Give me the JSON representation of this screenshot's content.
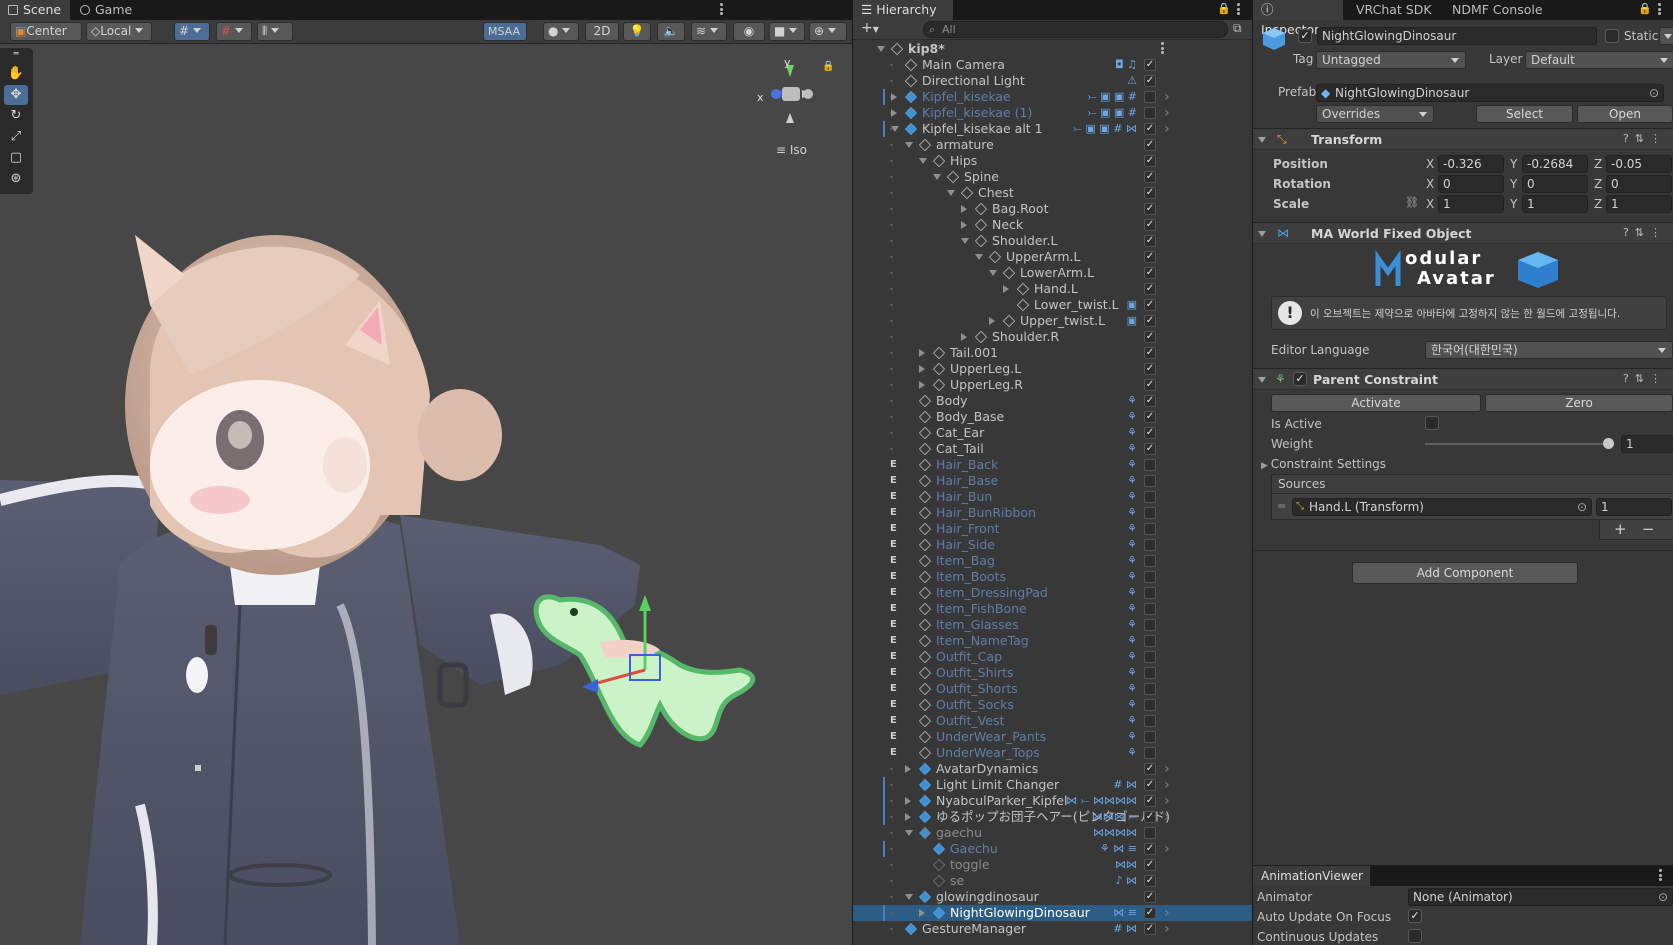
{
  "scene": {
    "tabs": [
      {
        "label": "Scene"
      },
      {
        "label": "Game"
      }
    ],
    "toolbar": {
      "pivot": "Center",
      "space": "Local",
      "msaa": "MSAA",
      "mode2d": "2D"
    },
    "iso_label": "Iso",
    "gizmo_axes": {
      "y": "y",
      "x": "x"
    }
  },
  "hierarchy": {
    "tab": "Hierarchy",
    "search_placeholder": "All",
    "rows": [
      {
        "label": "kip8*",
        "depth": 0,
        "fold": "down",
        "icon": "unity",
        "color": "white"
      },
      {
        "label": "Main Camera",
        "depth": 1,
        "fold": "none",
        "icon": "cube",
        "color": "white",
        "icons": "◘ ♫",
        "check": true
      },
      {
        "label": "Directional Light",
        "depth": 1,
        "fold": "none",
        "icon": "cube",
        "color": "white",
        "icons": "⚠",
        "check": true
      },
      {
        "label": "Kipfel_kisekae",
        "depth": 1,
        "fold": "right",
        "icon": "prefab",
        "color": "dblue",
        "icons": "⤚ ▣ ▣ #",
        "check": false,
        "bar": true,
        "arr": true
      },
      {
        "label": "Kipfel_kisekae (1)",
        "depth": 1,
        "fold": "right",
        "icon": "prefab",
        "color": "dblue",
        "icons": "⤚ ▣ ▣ #",
        "check": false,
        "arr": true
      },
      {
        "label": "Kipfel_kisekae alt 1",
        "depth": 1,
        "fold": "down",
        "icon": "prefab",
        "color": "blue",
        "icons": "⤚ ▣ ▣ # ⋈",
        "check": true,
        "bar": true,
        "arr": true
      },
      {
        "label": "armature",
        "depth": 2,
        "fold": "down",
        "icon": "cube",
        "color": "blue",
        "check": true
      },
      {
        "label": "Hips",
        "depth": 3,
        "fold": "down",
        "icon": "cube",
        "color": "blue",
        "check": true
      },
      {
        "label": "Spine",
        "depth": 4,
        "fold": "down",
        "icon": "cube",
        "color": "blue",
        "check": true
      },
      {
        "label": "Chest",
        "depth": 5,
        "fold": "down",
        "icon": "cube",
        "color": "blue",
        "check": true
      },
      {
        "label": "Bag.Root",
        "depth": 6,
        "fold": "right",
        "icon": "cube",
        "color": "blue",
        "check": true
      },
      {
        "label": "Neck",
        "depth": 6,
        "fold": "right",
        "icon": "cube",
        "color": "blue",
        "check": true
      },
      {
        "label": "Shoulder.L",
        "depth": 6,
        "fold": "down",
        "icon": "cube",
        "color": "blue",
        "check": true
      },
      {
        "label": "UpperArm.L",
        "depth": 7,
        "fold": "down",
        "icon": "cube",
        "color": "blue",
        "check": true
      },
      {
        "label": "LowerArm.L",
        "depth": 8,
        "fold": "down",
        "icon": "cube",
        "color": "blue",
        "check": true
      },
      {
        "label": "Hand.L",
        "depth": 9,
        "fold": "right",
        "icon": "cube",
        "color": "blue",
        "check": true
      },
      {
        "label": "Lower_twist.L",
        "depth": 9,
        "fold": "none",
        "icon": "cube",
        "color": "blue",
        "icons": "▣",
        "check": true
      },
      {
        "label": "Upper_twist.L",
        "depth": 8,
        "fold": "right",
        "icon": "cube",
        "color": "blue",
        "icons": "▣",
        "check": true
      },
      {
        "label": "Shoulder.R",
        "depth": 6,
        "fold": "right",
        "icon": "cube",
        "color": "blue",
        "check": true
      },
      {
        "label": "Tail.001",
        "depth": 3,
        "fold": "right",
        "icon": "cube",
        "color": "blue",
        "check": true
      },
      {
        "label": "UpperLeg.L",
        "depth": 3,
        "fold": "right",
        "icon": "cube",
        "color": "blue",
        "check": true
      },
      {
        "label": "UpperLeg.R",
        "depth": 3,
        "fold": "right",
        "icon": "cube",
        "color": "blue",
        "check": true
      },
      {
        "label": "Body",
        "depth": 2,
        "fold": "none",
        "icon": "cube",
        "color": "blue",
        "icons": "⚘",
        "check": true
      },
      {
        "label": "Body_Base",
        "depth": 2,
        "fold": "none",
        "icon": "cube",
        "color": "blue",
        "icons": "⚘",
        "check": true
      },
      {
        "label": "Cat_Ear",
        "depth": 2,
        "fold": "none",
        "icon": "cube",
        "color": "blue",
        "icons": "⚘",
        "check": true
      },
      {
        "label": "Cat_Tail",
        "depth": 2,
        "fold": "none",
        "icon": "cube",
        "color": "blue",
        "icons": "⚘",
        "check": true
      },
      {
        "label": "Hair_Back",
        "depth": 2,
        "fold": "none",
        "icon": "cube",
        "color": "dblue",
        "icons": "⚘",
        "check": false,
        "etag": true
      },
      {
        "label": "Hair_Base",
        "depth": 2,
        "fold": "none",
        "icon": "cube",
        "color": "dblue",
        "icons": "⚘",
        "check": false,
        "etag": true
      },
      {
        "label": "Hair_Bun",
        "depth": 2,
        "fold": "none",
        "icon": "cube",
        "color": "dblue",
        "icons": "⚘",
        "check": false,
        "etag": true
      },
      {
        "label": "Hair_BunRibbon",
        "depth": 2,
        "fold": "none",
        "icon": "cube",
        "color": "dblue",
        "icons": "⚘",
        "check": false,
        "etag": true
      },
      {
        "label": "Hair_Front",
        "depth": 2,
        "fold": "none",
        "icon": "cube",
        "color": "dblue",
        "icons": "⚘",
        "check": false,
        "etag": true
      },
      {
        "label": "Hair_Side",
        "depth": 2,
        "fold": "none",
        "icon": "cube",
        "color": "dblue",
        "icons": "⚘",
        "check": false,
        "etag": true
      },
      {
        "label": "Item_Bag",
        "depth": 2,
        "fold": "none",
        "icon": "cube",
        "color": "dblue",
        "icons": "⚘",
        "check": false,
        "etag": true
      },
      {
        "label": "Item_Boots",
        "depth": 2,
        "fold": "none",
        "icon": "cube",
        "color": "dblue",
        "icons": "⚘",
        "check": false,
        "etag": true
      },
      {
        "label": "Item_DressingPad",
        "depth": 2,
        "fold": "none",
        "icon": "cube",
        "color": "dblue",
        "icons": "⚘",
        "check": false,
        "etag": true
      },
      {
        "label": "Item_FishBone",
        "depth": 2,
        "fold": "none",
        "icon": "cube",
        "color": "dblue",
        "icons": "⚘",
        "check": false,
        "etag": true
      },
      {
        "label": "Item_Glasses",
        "depth": 2,
        "fold": "none",
        "icon": "cube",
        "color": "dblue",
        "icons": "⚘",
        "check": false,
        "etag": true
      },
      {
        "label": "Item_NameTag",
        "depth": 2,
        "fold": "none",
        "icon": "cube",
        "color": "dblue",
        "icons": "⚘",
        "check": false,
        "etag": true
      },
      {
        "label": "Outfit_Cap",
        "depth": 2,
        "fold": "none",
        "icon": "cube",
        "color": "dblue",
        "icons": "⚘",
        "check": false,
        "etag": true
      },
      {
        "label": "Outfit_Shirts",
        "depth": 2,
        "fold": "none",
        "icon": "cube",
        "color": "dblue",
        "icons": "⚘",
        "check": false,
        "etag": true
      },
      {
        "label": "Outfit_Shorts",
        "depth": 2,
        "fold": "none",
        "icon": "cube",
        "color": "dblue",
        "icons": "⚘",
        "check": false,
        "etag": true
      },
      {
        "label": "Outfit_Socks",
        "depth": 2,
        "fold": "none",
        "icon": "cube",
        "color": "dblue",
        "icons": "⚘",
        "check": false,
        "etag": true
      },
      {
        "label": "Outfit_Vest",
        "depth": 2,
        "fold": "none",
        "icon": "cube",
        "color": "dblue",
        "icons": "⚘",
        "check": false,
        "etag": true
      },
      {
        "label": "UnderWear_Pants",
        "depth": 2,
        "fold": "none",
        "icon": "cube",
        "color": "dblue",
        "icons": "⚘",
        "check": false,
        "etag": true
      },
      {
        "label": "UnderWear_Tops",
        "depth": 2,
        "fold": "none",
        "icon": "cube",
        "color": "dblue",
        "icons": "⚘",
        "check": false,
        "etag": true
      },
      {
        "label": "AvatarDynamics",
        "depth": 2,
        "fold": "right",
        "icon": "prefab",
        "color": "blue",
        "check": true,
        "arr": true
      },
      {
        "label": "Light Limit Changer",
        "depth": 2,
        "fold": "none",
        "icon": "prefab",
        "color": "blue",
        "icons": "# ⋈",
        "check": true,
        "bar": true,
        "arr": true
      },
      {
        "label": "NyabculParker_Kipfel",
        "depth": 2,
        "fold": "right",
        "icon": "prefab",
        "color": "blue",
        "icons": "⋈ ⤚ ⋈⋈⋈⋈",
        "check": true,
        "bar": true,
        "arr": true
      },
      {
        "label": "ゆるポップお団子ヘアー(ピンクゴールド)",
        "depth": 2,
        "fold": "right",
        "icon": "prefab",
        "color": "blue",
        "icons": "⋈⋈⋈ ⤚",
        "check": true,
        "bar": true,
        "arr": true
      },
      {
        "label": "gaechu",
        "depth": 2,
        "fold": "down",
        "icon": "prefab",
        "color": "grey",
        "icons": "⋈⋈⋈⋈",
        "check": false
      },
      {
        "label": "Gaechu",
        "depth": 3,
        "fold": "none",
        "icon": "prefab",
        "color": "dblue",
        "icons": "⚘ ⋈ ≡",
        "check": true,
        "bar": true,
        "arr": true
      },
      {
        "label": "toggle",
        "depth": 3,
        "fold": "none",
        "icon": "cube",
        "color": "grey",
        "icons": "⋈⋈",
        "check": true
      },
      {
        "label": "se",
        "depth": 3,
        "fold": "none",
        "icon": "cube",
        "color": "grey",
        "icons": "♪ ⋈",
        "check": true
      },
      {
        "label": "glowingdinosaur",
        "depth": 2,
        "fold": "down",
        "icon": "prefab",
        "color": "white",
        "check": true
      },
      {
        "label": "NightGlowingDinosaur",
        "depth": 3,
        "fold": "right",
        "icon": "prefab",
        "color": "white",
        "icons": "⋈ ≡",
        "check": true,
        "selected": true,
        "bar": true,
        "arr": true
      },
      {
        "label": "GestureManager",
        "depth": 1,
        "fold": "none",
        "icon": "prefab",
        "color": "blue",
        "icons": "# ⋈",
        "check": true,
        "arr": true
      }
    ]
  },
  "inspector": {
    "tabs": [
      {
        "label": "Inspector"
      },
      {
        "label": "VRChat SDK"
      },
      {
        "label": "NDMF Console"
      }
    ],
    "object_name": "NightGlowingDinosaur",
    "static_label": "Static",
    "tag_label": "Tag",
    "tag_value": "Untagged",
    "layer_label": "Layer",
    "layer_value": "Default",
    "prefab_label": "Prefab",
    "prefab_value": "NightGlowingDinosaur",
    "overrides": "Overrides",
    "select": "Select",
    "open": "Open",
    "transform": {
      "title": "Transform",
      "position": {
        "label": "Position",
        "x": "-0.326",
        "y": "-0.2684",
        "z": "-0.05"
      },
      "rotation": {
        "label": "Rotation",
        "x": "0",
        "y": "0",
        "z": "0"
      },
      "scale": {
        "label": "Scale",
        "x": "1",
        "y": "1",
        "z": "1"
      }
    },
    "ma_world": {
      "title": "MA World Fixed Object",
      "logo_line1": "odular",
      "logo_line2": "Avatar",
      "info": "이 오브젝트는 제약으로 아바타에 고정하지 않는 한 월드에 고정됩니다.",
      "editor_language_label": "Editor Language",
      "editor_language_value": "한국어(대한민국)"
    },
    "parent_constraint": {
      "title": "Parent Constraint",
      "activate": "Activate",
      "zero": "Zero",
      "is_active_label": "Is Active",
      "weight_label": "Weight",
      "weight_value": "1",
      "settings_label": "Constraint Settings",
      "sources_label": "Sources",
      "source_name": "Hand.L (Transform)",
      "source_weight": "1",
      "plus": "+",
      "minus": "−"
    },
    "add_component": "Add Component",
    "axes": {
      "x": "X",
      "y": "Y",
      "z": "Z"
    }
  },
  "animation_viewer": {
    "tab": "AnimationViewer",
    "animator_label": "Animator",
    "animator_value": "None (Animator)",
    "auto_update_label": "Auto Update On Focus",
    "continuous_label": "Continuous Updates"
  },
  "colors": {
    "selection": "#2c5d87",
    "accent": "#4c6e96",
    "prefab_blue": "#7fb7f4"
  }
}
